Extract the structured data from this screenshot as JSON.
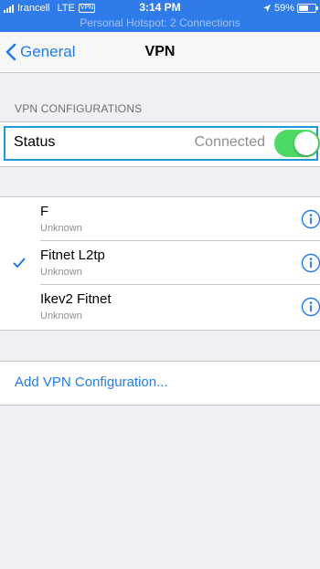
{
  "status_bar": {
    "carrier": "Irancell",
    "network": "LTE",
    "vpn_badge": "VPN",
    "time": "3:14 PM",
    "battery_percent": "59%",
    "battery_level": 0.59,
    "hotspot_text": "Personal Hotspot: 2 Connections"
  },
  "nav": {
    "back_label": "General",
    "title": "VPN"
  },
  "vpn_configurations": {
    "header": "VPN CONFIGURATIONS",
    "status_label": "Status",
    "status_value": "Connected",
    "toggle_on": true
  },
  "vpn_list": [
    {
      "name": "F",
      "subtitle": "Unknown",
      "selected": false
    },
    {
      "name": "Fitnet L2tp",
      "subtitle": "Unknown",
      "selected": true
    },
    {
      "name": "Ikev2 Fitnet",
      "subtitle": "Unknown",
      "selected": false
    }
  ],
  "add_vpn_label": "Add VPN Configuration...",
  "colors": {
    "accent": "#1f7cf3",
    "toggle_on": "#4cd964",
    "status_bar_bg": "#2f7bea",
    "highlight_border": "#1e9ad6",
    "page_bg": "#efeff4"
  },
  "icons": {
    "back": "chevron-left-icon",
    "selected": "checkmark-icon",
    "info": "info-circle-icon",
    "signal": "signal-bars-icon",
    "location": "location-arrow-icon",
    "battery": "battery-icon"
  }
}
